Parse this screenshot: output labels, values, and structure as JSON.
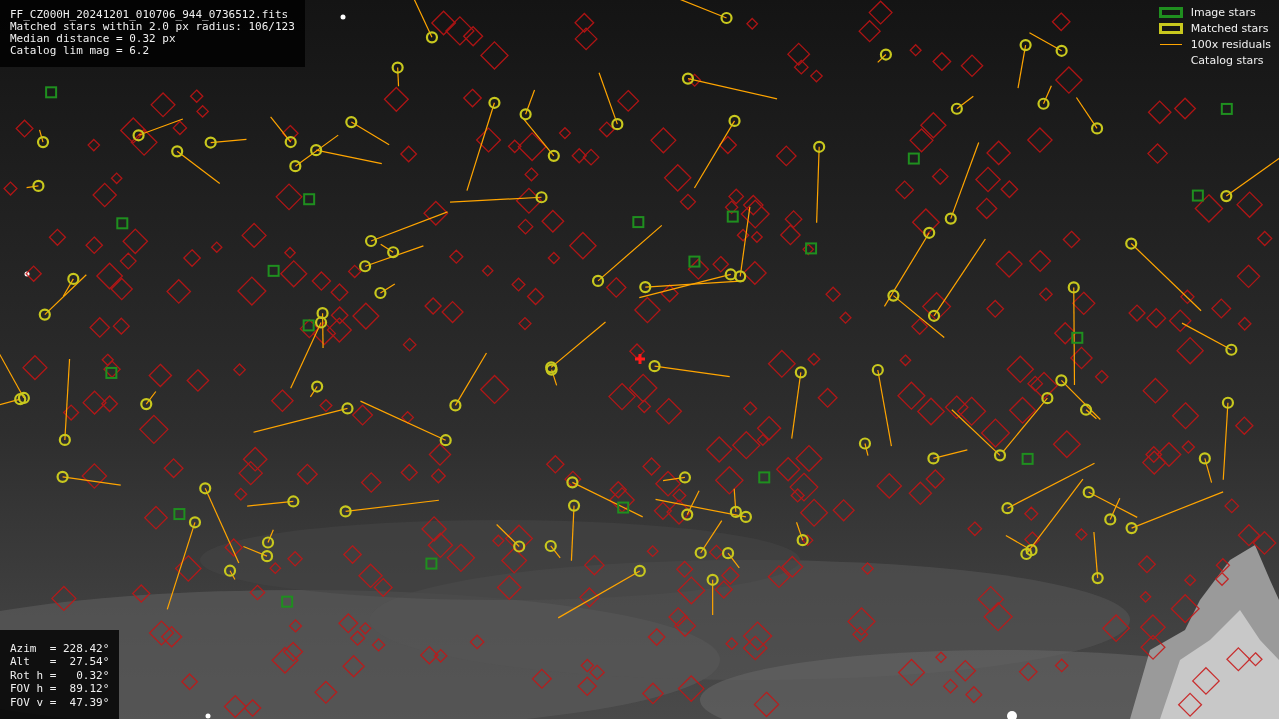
{
  "info_panel": {
    "lines": [
      "FF_CZ000H_20241201_010706_944_0736512.fits",
      "Matched stars within 2.0 px radius: 106/123",
      "Median distance = 0.32 px",
      "Catalog lim mag = 6.2"
    ]
  },
  "legend": [
    {
      "label": "Image stars",
      "color": "#1f8f1f"
    },
    {
      "kind": "matched",
      "label": "Matched stars",
      "color": "#c8c81e"
    },
    {
      "kind": "residual",
      "label": "100x residuals",
      "color": "#ffa500"
    },
    {
      "kind": "catalog",
      "label": "Catalog stars"
    }
  ],
  "pointing_panel": {
    "lines": [
      "Azim  = 228.42°",
      "Alt   =  27.54°",
      "Rot h =   0.32°",
      "FOV h =  89.12°",
      "FOV v =  47.39°"
    ]
  }
}
